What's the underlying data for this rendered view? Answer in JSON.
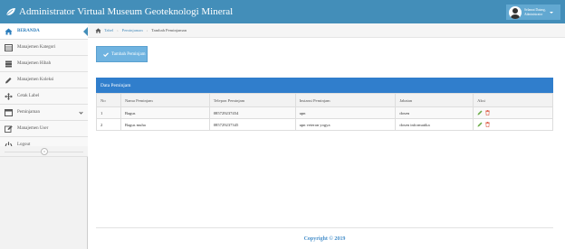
{
  "app": {
    "brand_title": "Administrator Virtual Museum Geoteknologi Mineral"
  },
  "user": {
    "greeting": "Selamat Datang,",
    "role": "Administrator"
  },
  "sidebar": {
    "items": [
      {
        "label": "BERANDA",
        "icon": "home-icon"
      },
      {
        "label": "Manajemen Kategori",
        "icon": "list-icon"
      },
      {
        "label": "Manajemen Hibah",
        "icon": "database-icon"
      },
      {
        "label": "Manajemen Koleksi",
        "icon": "pencil-icon"
      },
      {
        "label": "Cetak Label",
        "icon": "arrows-icon"
      },
      {
        "label": "Peminjaman",
        "icon": "calendar-icon"
      },
      {
        "label": "Manajemen User",
        "icon": "edit-icon"
      },
      {
        "label": "Logout",
        "icon": "power-icon"
      }
    ]
  },
  "breadcrumb": {
    "home": "Tabel",
    "section": "Peminjaman",
    "current": "Tambah Peminjaman"
  },
  "toolbar": {
    "add_label": "Tambah Peminjam"
  },
  "panel": {
    "title": "Data Peminjam"
  },
  "table": {
    "headers": [
      "No",
      "Nama Peminjam",
      "Telepon Peminjam",
      "Instansi Peminjam",
      "Jabatan",
      "Aksi"
    ],
    "rows": [
      {
        "no": "1",
        "nama": "Bagus",
        "telepon": "085729237454",
        "instansi": "upn",
        "jabatan": "dosen"
      },
      {
        "no": "2",
        "nama": "Bagus muha",
        "telepon": "085729237345",
        "instansi": "upn veteran yogya",
        "jabatan": "dosen informatika"
      }
    ]
  },
  "footer": {
    "copyright": "Copyright © 2019"
  },
  "colors": {
    "topbar": "#438eb9",
    "panel_header": "#307ecc",
    "add_button": "#6fb3e0",
    "edit_action": "#69aa46",
    "delete_action": "#dd5a43"
  }
}
